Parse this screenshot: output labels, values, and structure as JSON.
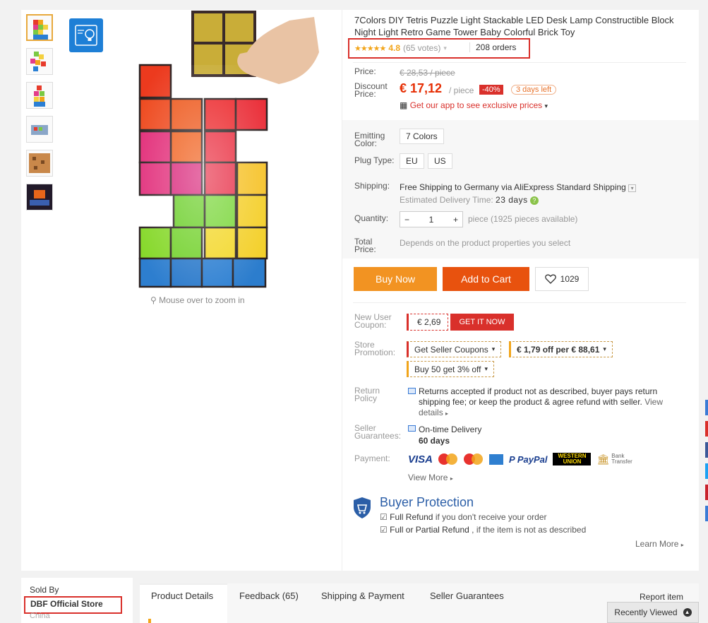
{
  "product": {
    "title": "7Colors DIY Tetris Puzzle Light Stackable LED Desk Lamp Constructible Block Night Light Retro Game Tower Baby Colorful Brick Toy",
    "rating_stars": "★★★★★",
    "rating_score": "4.8",
    "rating_votes": "(65 votes)",
    "orders": "208 orders",
    "zoom_hint": "Mouse over to zoom in"
  },
  "price": {
    "price_label": "Price:",
    "old_price": "€ 28,53 / piece",
    "discount_label": "Discount Price:",
    "new_price": "€ 17,12",
    "per_piece": "/ piece",
    "discount_badge": "-40%",
    "days_left": "3 days left",
    "app_promo": "Get our app to see exclusive prices"
  },
  "options": {
    "color_label": "Emitting Color:",
    "color_value": "7 Colors",
    "plug_label": "Plug Type:",
    "plug_values": [
      "EU",
      "US"
    ],
    "shipping_label": "Shipping:",
    "shipping_text": "Free Shipping to Germany via AliExpress Standard Shipping",
    "delivery_text": "Estimated Delivery Time:",
    "delivery_days": "23 days",
    "quantity_label": "Quantity:",
    "quantity_minus": "−",
    "quantity_value": "1",
    "quantity_plus": "+",
    "quantity_available": "piece (1925 pieces available)",
    "total_label": "Total Price:",
    "total_text": "Depends on the product properties you select"
  },
  "actions": {
    "buy_now": "Buy Now",
    "add_to_cart": "Add to Cart",
    "wishlist_count": "1029"
  },
  "coupons": {
    "new_user_label": "New User Coupon:",
    "new_user_value": "€ 2,69",
    "get_it_now": "GET IT NOW",
    "store_promo_label": "Store Promotion:",
    "seller_coupons": "Get Seller Coupons",
    "off_per": "€ 1,79 off per € 88,61",
    "buy_50": "Buy 50 get 3% off"
  },
  "policy": {
    "return_label": "Return Policy",
    "return_text": "Returns accepted if product not as described, buyer pays return shipping fee; or keep the product & agree refund with seller.",
    "view_details": "View details",
    "seller_label": "Seller Guarantees:",
    "on_time": "On-time Delivery",
    "days": "60 days",
    "payment_label": "Payment:",
    "payment_methods": [
      "VISA",
      "Maestro",
      "MasterCard",
      "Amex",
      "PayPal",
      "WESTERN UNION",
      "Bank Transfer"
    ],
    "view_more": "View More"
  },
  "protection": {
    "title": "Buyer Protection",
    "refund_strong": "Full Refund",
    "refund_text": " if you don't receive your order",
    "partial_strong": "Full or Partial Refund",
    "partial_text": " , if the item is not as described",
    "learn_more": "Learn More"
  },
  "store": {
    "sold_by": "Sold By",
    "name": "DBF Official Store",
    "country": "China"
  },
  "tabs": {
    "items": [
      "Product Details",
      "Feedback (65)",
      "Shipping & Payment",
      "Seller Guarantees"
    ],
    "report": "Report item",
    "recently_viewed": "Recently Viewed"
  },
  "colors": {
    "accent_red": "#d9302b",
    "price_red": "#e62e04",
    "buy_orange": "#f29322",
    "cart_orange": "#e8520e",
    "protection_blue": "#2b5ea7"
  }
}
